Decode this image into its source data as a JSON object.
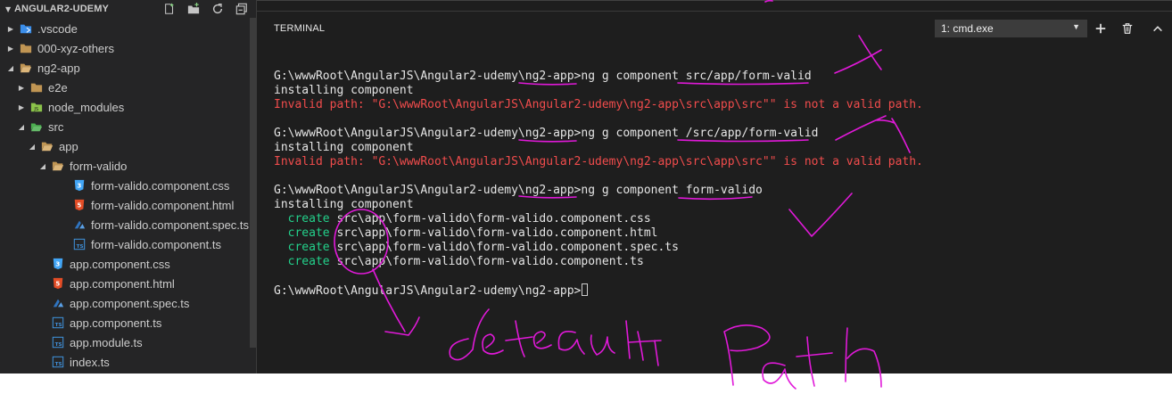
{
  "sidebar": {
    "title": "ANGULAR2-UDEMY",
    "actions": [
      "new-file-icon",
      "new-folder-icon",
      "refresh-icon",
      "collapse-all-icon"
    ],
    "items": [
      {
        "label": ".vscode",
        "depth": 1,
        "expanded": false,
        "kind": "folder-vscode"
      },
      {
        "label": "000-xyz-others",
        "depth": 1,
        "expanded": false,
        "kind": "folder"
      },
      {
        "label": "ng2-app",
        "depth": 1,
        "expanded": true,
        "kind": "folder-open"
      },
      {
        "label": "e2e",
        "depth": 2,
        "expanded": false,
        "kind": "folder"
      },
      {
        "label": "node_modules",
        "depth": 2,
        "expanded": false,
        "kind": "folder-node"
      },
      {
        "label": "src",
        "depth": 2,
        "expanded": true,
        "kind": "folder-src"
      },
      {
        "label": "app",
        "depth": 3,
        "expanded": true,
        "kind": "folder-open"
      },
      {
        "label": "form-valido",
        "depth": 4,
        "expanded": true,
        "kind": "folder-open"
      },
      {
        "label": "form-valido.component.css",
        "depth": 5,
        "kind": "css"
      },
      {
        "label": "form-valido.component.html",
        "depth": 5,
        "kind": "html"
      },
      {
        "label": "form-valido.component.spec.ts",
        "depth": 5,
        "kind": "spec"
      },
      {
        "label": "form-valido.component.ts",
        "depth": 5,
        "kind": "ts"
      },
      {
        "label": "app.component.css",
        "depth": 4,
        "kind": "css"
      },
      {
        "label": "app.component.html",
        "depth": 4,
        "kind": "html"
      },
      {
        "label": "app.component.spec.ts",
        "depth": 4,
        "kind": "spec"
      },
      {
        "label": "app.component.ts",
        "depth": 4,
        "kind": "ts"
      },
      {
        "label": "app.module.ts",
        "depth": 4,
        "kind": "ts"
      },
      {
        "label": "index.ts",
        "depth": 4,
        "kind": "ts"
      }
    ]
  },
  "panel": {
    "tab_label": "TERMINAL",
    "terminal_select": "1: cmd.exe",
    "buttons": [
      "plus-icon",
      "trash-icon",
      "chevron-up-icon"
    ]
  },
  "terminal": {
    "lines": [
      {
        "type": "cmd",
        "text": "G:\\wwwRoot\\AngularJS\\Angular2-udemy\\ng2-app>ng g component src/app/form-valid"
      },
      {
        "type": "out",
        "text": "installing component"
      },
      {
        "type": "err",
        "text": "Invalid path: \"G:\\wwwRoot\\AngularJS\\Angular2-udemy\\ng2-app\\src\\app\\src\"\" is not a valid path."
      },
      {
        "type": "blank",
        "text": ""
      },
      {
        "type": "cmd",
        "text": "G:\\wwwRoot\\AngularJS\\Angular2-udemy\\ng2-app>ng g component /src/app/form-valid"
      },
      {
        "type": "out",
        "text": "installing component"
      },
      {
        "type": "err",
        "text": "Invalid path: \"G:\\wwwRoot\\AngularJS\\Angular2-udemy\\ng2-app\\src\\app\\src\"\" is not a valid path."
      },
      {
        "type": "blank",
        "text": ""
      },
      {
        "type": "cmd",
        "text": "G:\\wwwRoot\\AngularJS\\Angular2-udemy\\ng2-app>ng g component form-valido"
      },
      {
        "type": "out",
        "text": "installing component"
      },
      {
        "type": "create",
        "verb": "  create",
        "text": " src\\app\\form-valido\\form-valido.component.css"
      },
      {
        "type": "create",
        "verb": "  create",
        "text": " src\\app\\form-valido\\form-valido.component.html"
      },
      {
        "type": "create",
        "verb": "  create",
        "text": " src\\app\\form-valido\\form-valido.component.spec.ts"
      },
      {
        "type": "create",
        "verb": "  create",
        "text": " src\\app\\form-valido\\form-valido.component.ts"
      },
      {
        "type": "blank",
        "text": ""
      },
      {
        "type": "prompt",
        "text": "G:\\wwwRoot\\AngularJS\\Angular2-udemy\\ng2-app>"
      }
    ]
  },
  "annotation": {
    "handwritten_text": "default Path",
    "color": "#e019d8"
  },
  "colors": {
    "sidebar_bg": "#252526",
    "terminal_bg": "#1e1e1e",
    "error": "#f14c4c",
    "create": "#23d18b"
  }
}
